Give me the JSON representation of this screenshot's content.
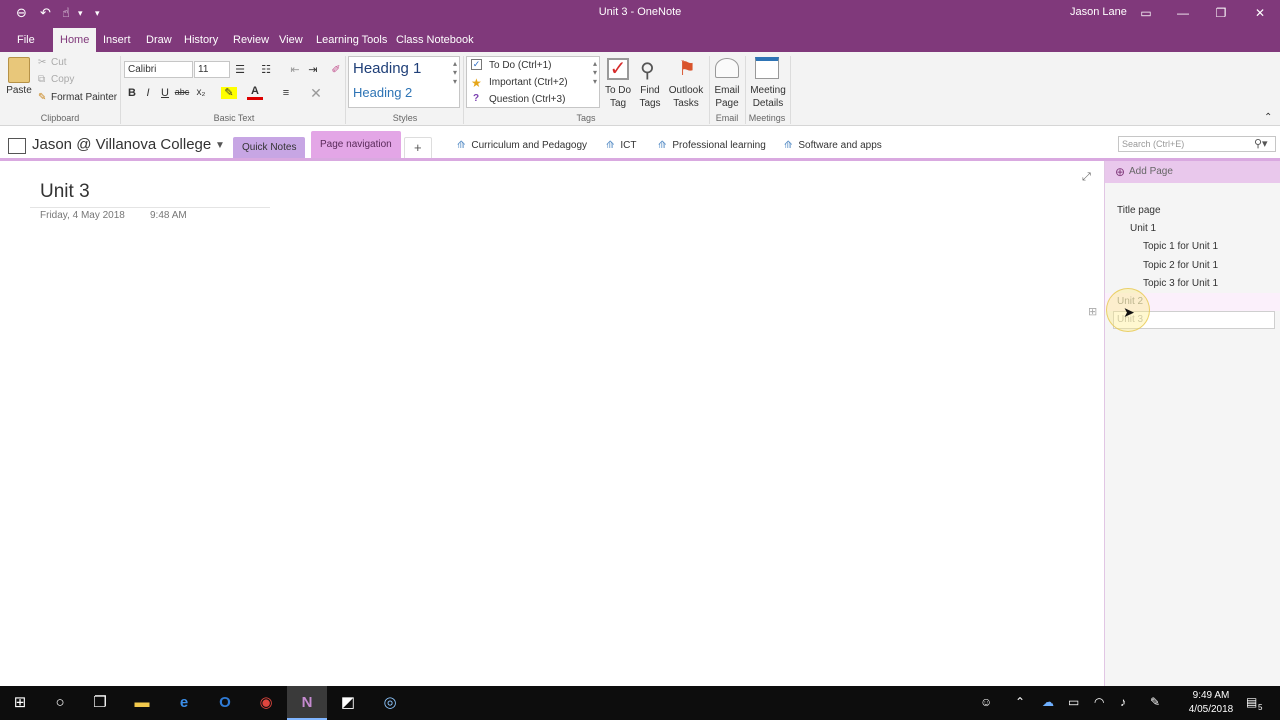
{
  "window": {
    "title": "Unit 3  -  OneNote",
    "user": "Jason Lane"
  },
  "tabs": [
    "File",
    "Home",
    "Insert",
    "Draw",
    "History",
    "Review",
    "View",
    "Learning Tools",
    "Class Notebook"
  ],
  "ribbon": {
    "clipboard": {
      "paste": "Paste",
      "cut": "Cut",
      "copy": "Copy",
      "format_painter": "Format Painter",
      "label": "Clipboard"
    },
    "basic_text": {
      "font": "Calibri",
      "size": "11",
      "label": "Basic Text"
    },
    "styles": {
      "heading1": "Heading 1",
      "heading2": "Heading 2",
      "label": "Styles"
    },
    "tags": {
      "items": [
        "To Do (Ctrl+1)",
        "Important (Ctrl+2)",
        "Question (Ctrl+3)"
      ],
      "todo_tag": "To Do\nTag",
      "find_tags": "Find\nTags",
      "outlook_tasks": "Outlook\nTasks",
      "label": "Tags"
    },
    "email": {
      "button": "Email\nPage",
      "label": "Email"
    },
    "meetings": {
      "button": "Meeting\nDetails",
      "label": "Meetings"
    }
  },
  "notebook": {
    "name": "Jason @ Villanova College",
    "sections": [
      "Quick Notes",
      "Page navigation"
    ],
    "add_section": "+",
    "groups": [
      "Curriculum and Pedagogy",
      "ICT",
      "Professional learning",
      "Software and apps"
    ],
    "search_placeholder": "Search (Ctrl+E)"
  },
  "page": {
    "title": "Unit 3",
    "date": "Friday, 4 May 2018",
    "time": "9:48 AM"
  },
  "pages_pane": {
    "add_page": "Add Page",
    "items": [
      "Title page",
      "Unit 1",
      "Topic 1 for Unit 1",
      "Topic 2 for Unit 1",
      "Topic 3 for Unit 1",
      "Unit 2"
    ],
    "editing_item": "Unit 3"
  },
  "taskbar": {
    "time": "9:49 AM",
    "date": "4/05/2018",
    "notifications": "5"
  },
  "colors": {
    "accent": "#80397b",
    "section_quick_notes": "#c7a6e4",
    "section_page_navigation": "#e3a6e6"
  }
}
